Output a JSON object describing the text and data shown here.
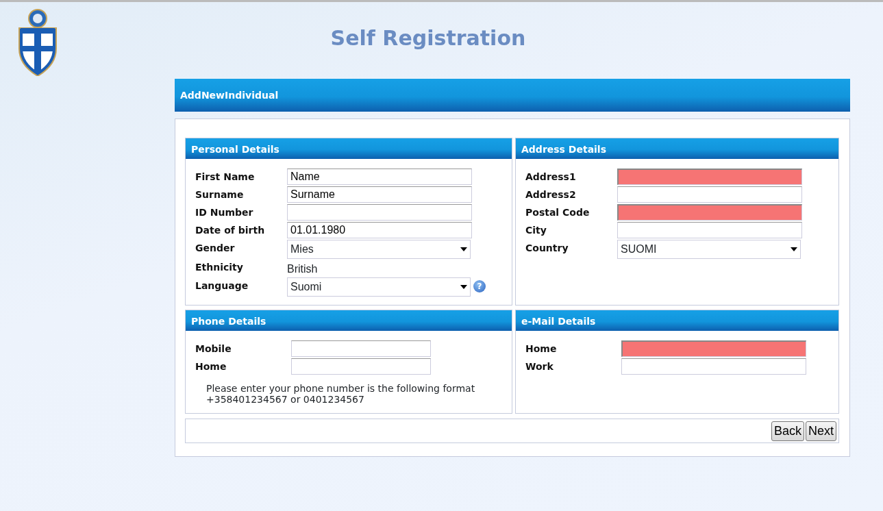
{
  "page_title": "Self Registration",
  "panel_title": "AddNewIndividual",
  "sections": [
    {
      "title": "Personal Details",
      "fields": [
        {
          "label": "First Name",
          "kind": "text",
          "value": "Name",
          "invalid": false
        },
        {
          "label": "Surname",
          "kind": "text",
          "value": "Surname",
          "invalid": false
        },
        {
          "label": "ID Number",
          "kind": "text",
          "invalid": false
        },
        {
          "label": "Date of birth",
          "kind": "text",
          "value": "01.01.1980",
          "invalid": false
        },
        {
          "label": "Gender",
          "kind": "select",
          "value": "Mies"
        },
        {
          "label": "Ethnicity",
          "kind": "static",
          "value": "British"
        },
        {
          "label": "Language",
          "kind": "select",
          "value": "Suomi",
          "help": "?"
        }
      ]
    },
    {
      "title": "Address Details",
      "fields": [
        {
          "label": "Address1",
          "kind": "text",
          "invalid": true
        },
        {
          "label": "Address2",
          "kind": "text",
          "invalid": false
        },
        {
          "label": "Postal Code",
          "kind": "text",
          "invalid": true
        },
        {
          "label": "City",
          "kind": "text",
          "invalid": false
        },
        {
          "label": "Country",
          "kind": "select",
          "value": "SUOMI"
        }
      ]
    },
    {
      "title": "Phone Details",
      "fields": [
        {
          "label": "Mobile",
          "kind": "text",
          "invalid": false
        },
        {
          "label": "Home",
          "kind": "text",
          "invalid": false
        }
      ],
      "note": "Please enter your phone number is the following format +358401234567 or 0401234567"
    },
    {
      "title": "e-Mail Details",
      "fields": [
        {
          "label": "Home",
          "kind": "text",
          "invalid": true
        },
        {
          "label": "Work",
          "kind": "text",
          "invalid": false
        }
      ]
    }
  ],
  "buttons": [
    "Back",
    "Next"
  ]
}
